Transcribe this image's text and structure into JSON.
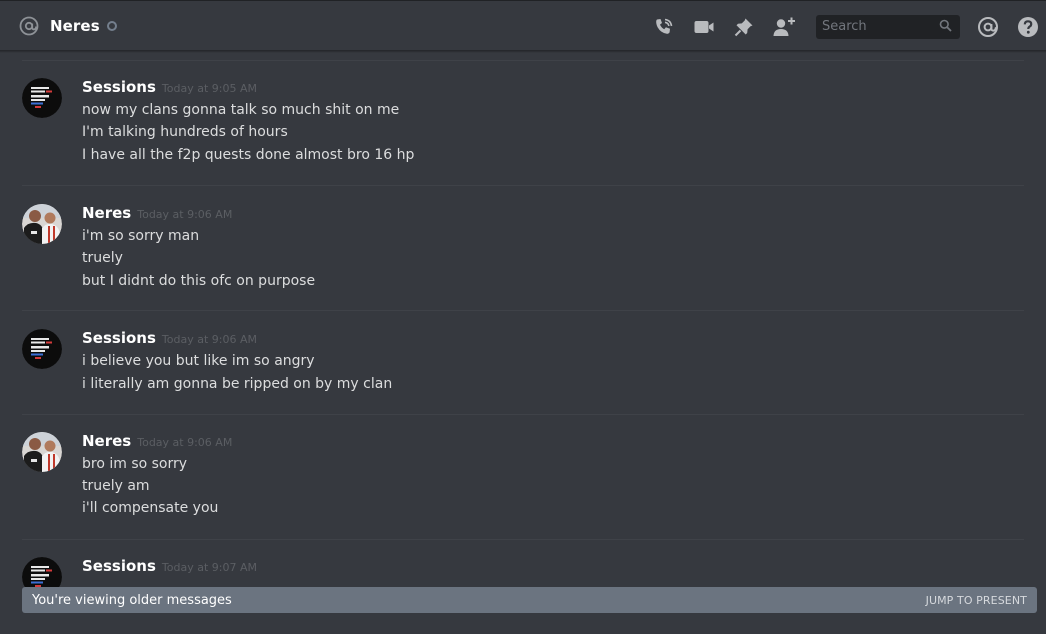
{
  "header": {
    "title": "Neres",
    "search_placeholder": "Search",
    "icons": [
      "at-icon",
      "status-dot",
      "call-icon",
      "video-icon",
      "pin-icon",
      "add-friend-icon",
      "search-icon",
      "mentions-icon",
      "help-icon"
    ]
  },
  "colors": {
    "background": "#36393f",
    "header_text": "#ffffff",
    "message_text": "#dcddde",
    "timestamp": "#5b5e63",
    "divider": "#3f4248",
    "banner": "#6b7480"
  },
  "messages": [
    {
      "author": "Sessions",
      "timestamp": "Today at 9:05 AM",
      "lines": [
        "now my clans gonna talk so much shit on me",
        "I'm talking hundreds of hours",
        "I have all the f2p quests done almost bro 16 hp"
      ]
    },
    {
      "author": "Neres",
      "timestamp": "Today at 9:06 AM",
      "lines": [
        "i'm so sorry man",
        "truely",
        "but I didnt do this ofc on purpose"
      ]
    },
    {
      "author": "Sessions",
      "timestamp": "Today at 9:06 AM",
      "lines": [
        "i believe you but like im so angry",
        "i literally am gonna be ripped on by my clan"
      ]
    },
    {
      "author": "Neres",
      "timestamp": "Today at 9:06 AM",
      "lines": [
        "bro im so sorry",
        "truely am",
        "i'll compensate you"
      ]
    },
    {
      "author": "Sessions",
      "timestamp": "Today at 9:07 AM",
      "lines": []
    }
  ],
  "banner": {
    "text": "You're viewing older messages",
    "action": "JUMP TO PRESENT"
  }
}
